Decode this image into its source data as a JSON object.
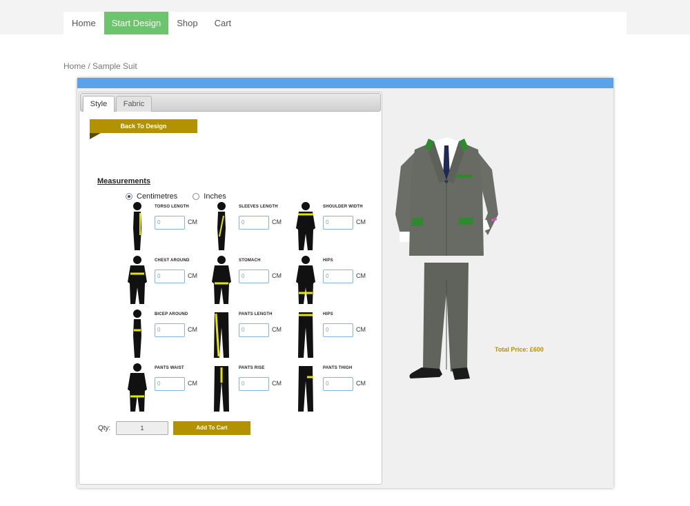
{
  "nav": {
    "items": [
      {
        "label": "Home",
        "active": false
      },
      {
        "label": "Start Design",
        "active": true
      },
      {
        "label": "Shop",
        "active": false
      },
      {
        "label": "Cart",
        "active": false
      }
    ],
    "active_color": "#6cc56c"
  },
  "breadcrumb": {
    "home": "Home",
    "separator": " / ",
    "current": "Sample Suit"
  },
  "designer": {
    "header_color": "#5aa3e8",
    "tabs": [
      {
        "label": "Style",
        "selected": true
      },
      {
        "label": "Fabric",
        "selected": false
      }
    ],
    "back_button": "Back To Design",
    "accent_color": "#b39200",
    "measurements_title": "Measurements",
    "units": [
      {
        "label": "Centimetres",
        "checked": true
      },
      {
        "label": "Inches",
        "checked": false
      }
    ],
    "fields": [
      {
        "label": "TORSO LENGTH",
        "placeholder": "0",
        "unit": "CM",
        "icon": "torso-length-figure-icon"
      },
      {
        "label": "SLEEVES LENGTH",
        "placeholder": "0",
        "unit": "CM",
        "icon": "sleeves-length-figure-icon"
      },
      {
        "label": "SHOULDER WIDTH",
        "placeholder": "0",
        "unit": "CM",
        "icon": "shoulder-width-figure-icon"
      },
      {
        "label": "CHEST AROUND",
        "placeholder": "0",
        "unit": "CM",
        "icon": "chest-around-figure-icon"
      },
      {
        "label": "STOMACH",
        "placeholder": "0",
        "unit": "CM",
        "icon": "stomach-figure-icon"
      },
      {
        "label": "HIPS",
        "placeholder": "0",
        "unit": "CM",
        "icon": "hips-figure-icon"
      },
      {
        "label": "BICEP AROUND",
        "placeholder": "0",
        "unit": "CM",
        "icon": "bicep-around-figure-icon"
      },
      {
        "label": "PANTS LENGTH",
        "placeholder": "0",
        "unit": "CM",
        "icon": "pants-length-figure-icon"
      },
      {
        "label": "HIPS",
        "placeholder": "0",
        "unit": "CM",
        "icon": "hips-legs-figure-icon"
      },
      {
        "label": "PANTS WAIST",
        "placeholder": "0",
        "unit": "CM",
        "icon": "pants-waist-figure-icon"
      },
      {
        "label": "PANTS RISE",
        "placeholder": "0",
        "unit": "CM",
        "icon": "pants-rise-figure-icon"
      },
      {
        "label": "PANTS THIGH",
        "placeholder": "0",
        "unit": "CM",
        "icon": "pants-thigh-figure-icon"
      }
    ],
    "qty_label": "Qty:",
    "qty_value": "1",
    "add_to_cart": "Add To Cart",
    "total_price": "Total Price: £600"
  }
}
